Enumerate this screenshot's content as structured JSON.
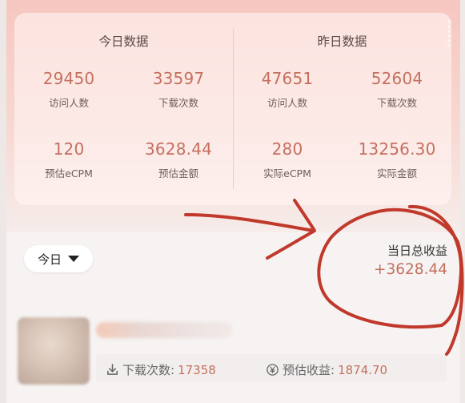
{
  "today": {
    "title": "今日数据",
    "stats": [
      {
        "value": "29450",
        "label": "访问人数"
      },
      {
        "value": "33597",
        "label": "下载次数"
      },
      {
        "value": "120",
        "label": "预估eCPM"
      },
      {
        "value": "3628.44",
        "label": "预估金额"
      }
    ]
  },
  "yesterday": {
    "title": "昨日数据",
    "stats": [
      {
        "value": "47651",
        "label": "访问人数"
      },
      {
        "value": "52604",
        "label": "下载次数"
      },
      {
        "value": "280",
        "label": "实际eCPM"
      },
      {
        "value": "13256.30",
        "label": "实际金额"
      }
    ]
  },
  "filter": {
    "selected": "今日"
  },
  "total": {
    "label": "当日总收益",
    "value": "+3628.44"
  },
  "item": {
    "downloads_label": "下载次数:",
    "downloads_value": "17358",
    "revenue_label": "预估收益:",
    "revenue_value": "1874.70"
  },
  "colors": {
    "accent": "#c4705f",
    "annotation": "#c0392b"
  }
}
